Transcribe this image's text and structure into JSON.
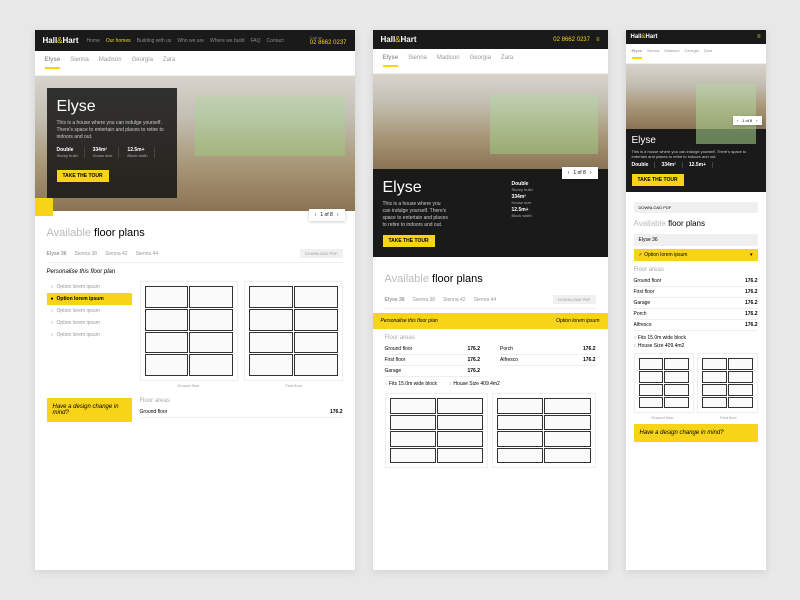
{
  "brand": {
    "part1": "Hall",
    "amp": "&",
    "part2": "Hart",
    "sub": "HOMES"
  },
  "nav": [
    "Home",
    "Our homes",
    "Building with us",
    "Who we are",
    "Where we build",
    "FAQ",
    "Contact"
  ],
  "phone": {
    "label": "Call us",
    "number": "02 8662 0237"
  },
  "tabs": [
    "Elyse",
    "Sienna",
    "Madison",
    "Georgia",
    "Zara"
  ],
  "hero": {
    "title": "Elyse",
    "desc": "This is a house where you can indulge yourself. There's space to entertain and places to retire to indoors and out.",
    "stats": [
      {
        "val": "Double",
        "label": "Storey build"
      },
      {
        "val": "334m²",
        "label": "House size"
      },
      {
        "val": "12.5m+",
        "label": "Block width"
      }
    ],
    "cta": "TAKE THE TOUR",
    "pager": "1 of 8"
  },
  "floorplans": {
    "title_light": "Available",
    "title_bold": "floor plans",
    "subtabs": [
      "Elyse 36",
      "Sienna 38",
      "Sienna 42",
      "Sienna 44"
    ],
    "download": "DOWNLOAD PDF",
    "personalise": "Personalise this floor plan",
    "options": [
      "Option lorem ipsum",
      "Option lorem ipsum",
      "Option lorem ipsum",
      "Option lorem ipsum",
      "Option lorem ipsum"
    ],
    "option_dropdown": "Option lorem ipsum",
    "plan_labels": [
      "Ground floor",
      "First floor"
    ],
    "design_prompt": "Have a design change in mind?"
  },
  "floor_areas": {
    "title": "Floor areas",
    "unit": "m²",
    "rows": [
      {
        "label": "Ground floor",
        "val": "176.2"
      },
      {
        "label": "First floor",
        "val": "176.2"
      },
      {
        "label": "Garage",
        "val": "176.2"
      },
      {
        "label": "Porch",
        "val": "176.2"
      },
      {
        "label": "Alfresco",
        "val": "176.2"
      }
    ],
    "checks": [
      "Fits 15.0m wide block",
      "House Size 409.4m2"
    ]
  }
}
